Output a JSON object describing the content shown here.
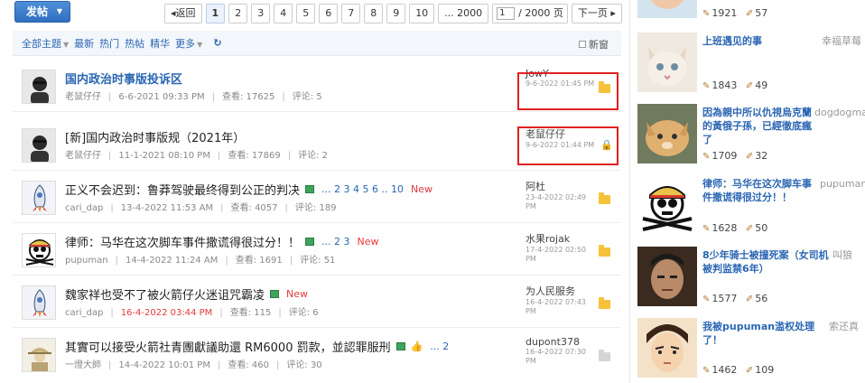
{
  "toolbar": {
    "post_label": "发帖"
  },
  "pager": {
    "back": "返回",
    "pages": [
      "1",
      "2",
      "3",
      "4",
      "5",
      "6",
      "7",
      "8",
      "9",
      "10"
    ],
    "ellipsis_last": "... 2000",
    "input_value": "1",
    "total": "/ 2000 页",
    "next": "下一页"
  },
  "filter": {
    "all": "全部主题",
    "latest": "最新",
    "hot": "热门",
    "hotposts": "热帖",
    "digest": "精华",
    "more": "更多",
    "newwin": "新窗"
  },
  "threads": [
    {
      "title": "国内政治时事版投诉区",
      "author": "老鼠仔仔",
      "date": "6-6-2021 09:33 PM",
      "views_label": "查看:",
      "views": "17625",
      "replies_label": "评论:",
      "replies": "5",
      "last_user": "JowY",
      "last_time": "9-6-2022 01:45 PM"
    },
    {
      "title": "[新]国内政治时事版规（2021年）",
      "author": "老鼠仔仔",
      "date": "11-1-2021 08:10 PM",
      "views_label": "查看:",
      "views": "17869",
      "replies_label": "评论:",
      "replies": "2",
      "last_user": "老鼠仔仔",
      "last_time": "9-6-2022 01:44 PM"
    },
    {
      "title": "正义不会迟到：鲁莽驾驶最终得到公正的判决",
      "pages": "... 2 3 4 5 6 .. 10",
      "new": "New",
      "author": "cari_dap",
      "date": "13-4-2022 11:53 AM",
      "views_label": "查看:",
      "views": "4057",
      "replies_label": "评论:",
      "replies": "189",
      "last_user": "阿杜",
      "last_time": "23-4-2022 02:49 PM"
    },
    {
      "title": "律师：马华在这次脚车事件撒谎得很过分！！",
      "pages": "... 2 3",
      "new": "New",
      "author": "pupuman",
      "date": "14-4-2022 11:24 AM",
      "views_label": "查看:",
      "views": "1691",
      "replies_label": "评论:",
      "replies": "51",
      "last_user": "水果rojak",
      "last_time": "17-4-2022 02:50 PM"
    },
    {
      "title": "魏家祥也受不了被火箭仔火迷诅咒霸凌",
      "new": "New",
      "author": "cari_dap",
      "date": "16-4-2022 03:44 PM",
      "views_label": "查看:",
      "views": "115",
      "replies_label": "评论:",
      "replies": "6",
      "last_user": "为人民服务",
      "last_time": "16-4-2022 07:43 PM"
    },
    {
      "title": "其實可以接受火箭社青團獻議助還 RM6000 罰款，並認罪服刑",
      "pages": "... 2",
      "author": "一燈大師",
      "date": "14-4-2022 10:01 PM",
      "views_label": "查看:",
      "views": "460",
      "replies_label": "评论:",
      "replies": "30",
      "last_user": "dupont378",
      "last_time": "16-4-2022 07:30 PM"
    }
  ],
  "sidebar": [
    {
      "views": "1921",
      "replies": "57"
    },
    {
      "title": "上班遇见的事",
      "author": "幸福草莓",
      "views": "1843",
      "replies": "49"
    },
    {
      "title": "因為親中所以仇視烏克蘭的黃俄子孫，已經徹底瘋了",
      "author": "dogdogman",
      "views": "1709",
      "replies": "32"
    },
    {
      "title": "律师：马华在这次脚车事件撒谎得很过分！！",
      "author": "pupuman",
      "views": "1628",
      "replies": "50"
    },
    {
      "title": "8少年骑士被撞死案（女司机被判监禁6年）",
      "author": "叫狼",
      "views": "1577",
      "replies": "56"
    },
    {
      "title": "我被pupuman滥权处理了！",
      "author": "索还真",
      "views": "1462",
      "replies": "109"
    }
  ]
}
